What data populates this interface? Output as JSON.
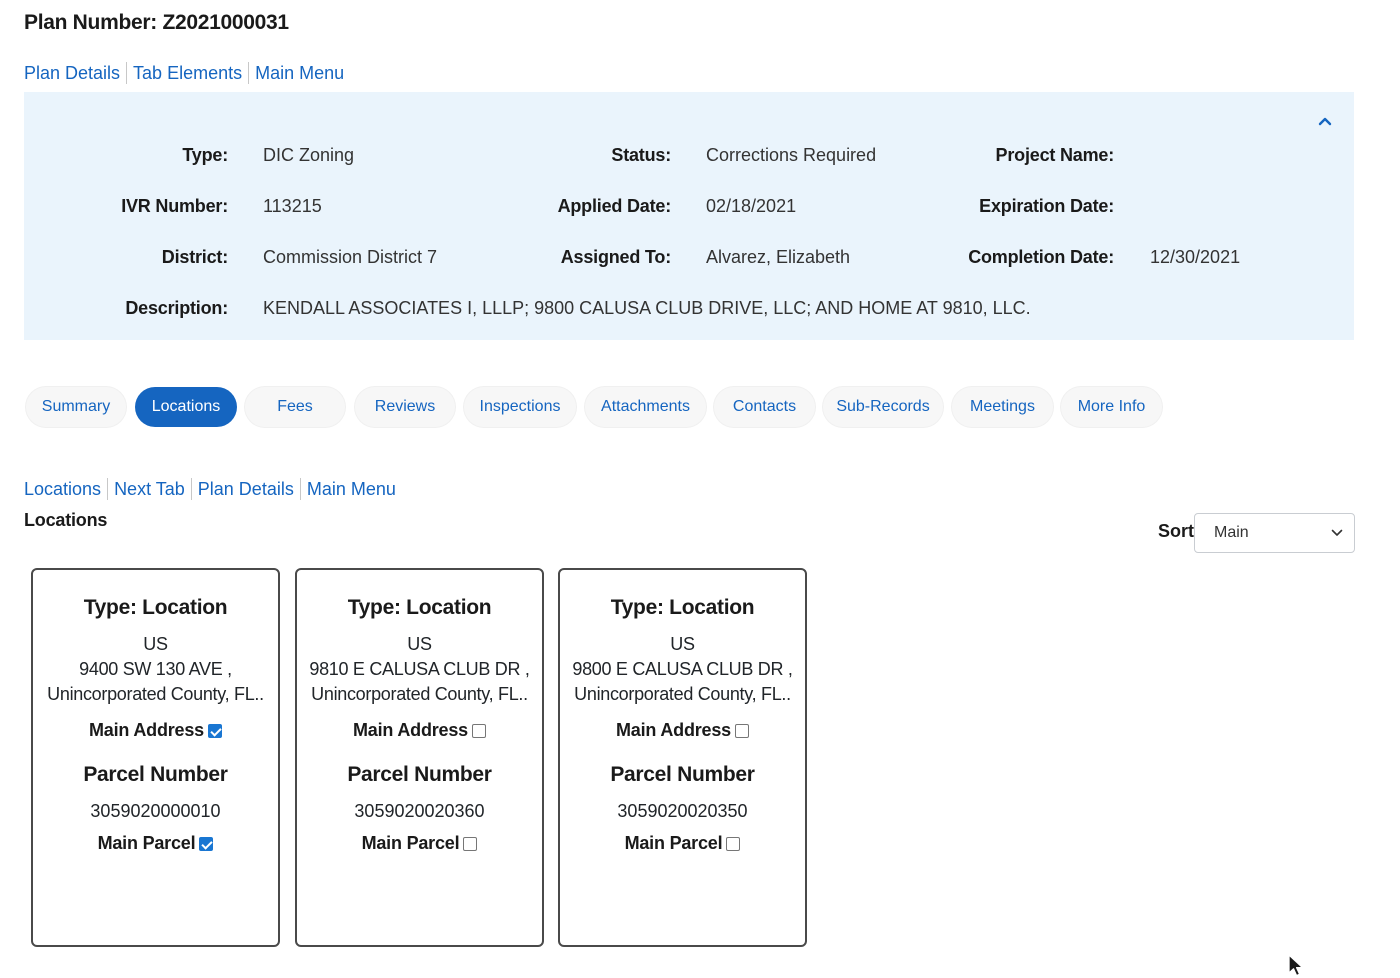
{
  "page": {
    "title": "Plan Number: Z2021000031"
  },
  "top_links": [
    "Plan Details",
    "Tab Elements",
    "Main Menu"
  ],
  "summary": {
    "type_label": "Type:",
    "type_value": "DIC Zoning",
    "status_label": "Status:",
    "status_value": "Corrections Required",
    "project_name_label": "Project Name:",
    "project_name_value": "",
    "ivr_label": "IVR Number:",
    "ivr_value": "113215",
    "applied_label": "Applied Date:",
    "applied_value": "02/18/2021",
    "expiration_label": "Expiration Date:",
    "expiration_value": "",
    "district_label": "District:",
    "district_value": "Commission District 7",
    "assigned_label": "Assigned To:",
    "assigned_value": "Alvarez, Elizabeth",
    "completion_label": "Completion Date:",
    "completion_value": "12/30/2021",
    "description_label": "Description:",
    "description_value": "KENDALL ASSOCIATES I, LLLP; 9800 CALUSA CLUB DRIVE, LLC; AND HOME AT 9810, LLC."
  },
  "tabs": [
    "Summary",
    "Locations",
    "Fees",
    "Reviews",
    "Inspections",
    "Attachments",
    "Contacts",
    "Sub-Records",
    "Meetings",
    "More Info"
  ],
  "active_tab": "Locations",
  "section_links": [
    "Locations",
    "Next Tab",
    "Plan Details",
    "Main Menu"
  ],
  "section_title": "Locations",
  "sort": {
    "label": "Sort",
    "selected": "Main"
  },
  "locations": [
    {
      "type": "Type: Location",
      "country": "US",
      "street": "9400 SW 130 AVE ,",
      "city": "Unincorporated County, FL..",
      "main_address_label": "Main Address",
      "main_address_checked": true,
      "parcel_heading": "Parcel Number",
      "parcel_number": "3059020000010",
      "main_parcel_label": "Main Parcel",
      "main_parcel_checked": true
    },
    {
      "type": "Type: Location",
      "country": "US",
      "street": "9810 E CALUSA CLUB DR ,",
      "city": "Unincorporated County, FL..",
      "main_address_label": "Main Address",
      "main_address_checked": false,
      "parcel_heading": "Parcel Number",
      "parcel_number": "3059020020360",
      "main_parcel_label": "Main Parcel",
      "main_parcel_checked": false
    },
    {
      "type": "Type: Location",
      "country": "US",
      "street": "9800 E CALUSA CLUB DR ,",
      "city": "Unincorporated County, FL..",
      "main_address_label": "Main Address",
      "main_address_checked": false,
      "parcel_heading": "Parcel Number",
      "parcel_number": "3059020020350",
      "main_parcel_label": "Main Parcel",
      "main_parcel_checked": false
    }
  ],
  "colors": {
    "link": "#1565c0",
    "panel_bg": "#eaf4fc",
    "active_tab_bg": "#1565c0",
    "checkbox_checked": "#1976d2"
  },
  "icons": {
    "collapse": "chevron-up-icon",
    "sort_dropdown": "chevron-down-icon",
    "pointer": "mouse-cursor-icon"
  }
}
